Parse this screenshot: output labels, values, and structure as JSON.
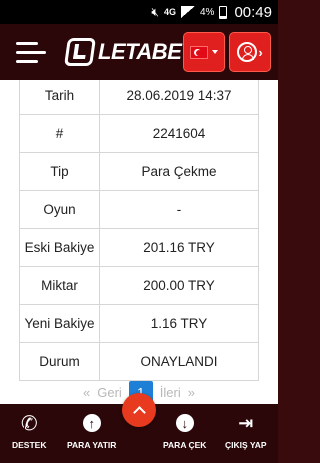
{
  "status_bar": {
    "network": "4G",
    "battery": "4%",
    "time": "00:49"
  },
  "header": {
    "logo_text": "LETABET",
    "language": "TR"
  },
  "transaction": {
    "rows": [
      {
        "label": "Tarih",
        "value": "28.06.2019 14:37"
      },
      {
        "label": "#",
        "value": "2241604"
      },
      {
        "label": "Tip",
        "value": "Para Çekme"
      },
      {
        "label": "Oyun",
        "value": "-"
      },
      {
        "label": "Eski Bakiye",
        "value": "201.16 TRY"
      },
      {
        "label": "Miktar",
        "value": "200.00 TRY"
      },
      {
        "label": "Yeni Bakiye",
        "value": "1.16 TRY"
      },
      {
        "label": "Durum",
        "value": "ONAYLANDI"
      }
    ]
  },
  "pagination": {
    "first": "«",
    "prev": "Geri",
    "current": "1",
    "next": "İleri",
    "last": "»"
  },
  "bottom_nav": {
    "support": "DESTEK",
    "deposit": "PARA YATIR",
    "withdraw": "PARA ÇEK",
    "logout": "ÇIKIŞ YAP"
  },
  "icons": {
    "mute": "mute-icon",
    "signal": "signal-icon",
    "battery": "battery-icon",
    "menu": "hamburger-icon",
    "user": "user-icon",
    "scroll_top": "chevron-up-icon"
  },
  "colors": {
    "header_bg": "#2b0709",
    "accent": "#e0201f",
    "pager_active": "#1e7fd6"
  }
}
